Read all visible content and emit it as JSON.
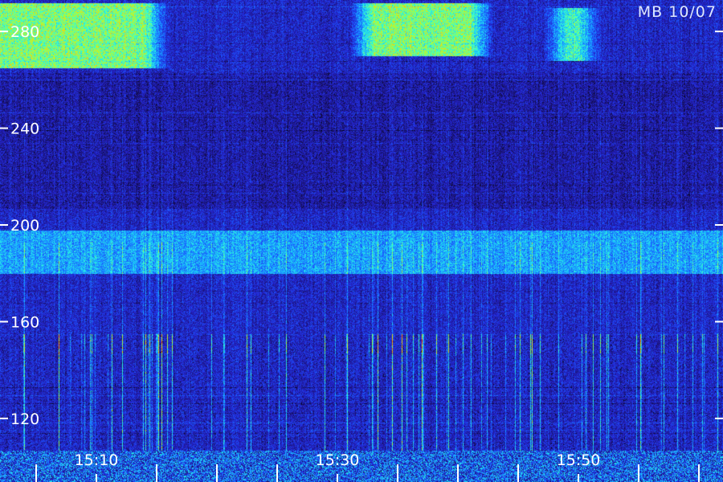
{
  "chart_data": {
    "type": "heatmap",
    "title": "MB 10/07",
    "y_axis": {
      "unit": "",
      "range": [
        107,
        293
      ],
      "ticks": [
        280,
        240,
        200,
        160,
        120
      ]
    },
    "x_axis": {
      "range": [
        "15:02",
        "16:02"
      ],
      "labeled_ticks": [
        "15:10",
        "15:30",
        "15:50"
      ],
      "minor_tick_interval_minutes": 5
    },
    "colormap": [
      "#000000",
      "#1b1478",
      "#2424d0",
      "#1a5cff",
      "#19b8ff",
      "#30ffd8",
      "#a8ff3c",
      "#ffd000",
      "#ff3a00"
    ],
    "bands": [
      {
        "freq_range": [
          265,
          292
        ],
        "time_range": [
          "15:02",
          "15:14"
        ],
        "level": "high"
      },
      {
        "freq_range": [
          270,
          292
        ],
        "time_range": [
          "15:33",
          "15:41"
        ],
        "level": "high"
      },
      {
        "freq_range": [
          268,
          290
        ],
        "time_range": [
          "15:49",
          "15:50"
        ],
        "level": "medium-high"
      },
      {
        "freq_range": [
          180,
          198
        ],
        "time_range": [
          "15:02",
          "16:02"
        ],
        "level": "medium"
      },
      {
        "freq_range": [
          107,
          155
        ],
        "time_range": [
          "15:02",
          "16:02"
        ],
        "level": "impulsive bursts"
      }
    ]
  }
}
